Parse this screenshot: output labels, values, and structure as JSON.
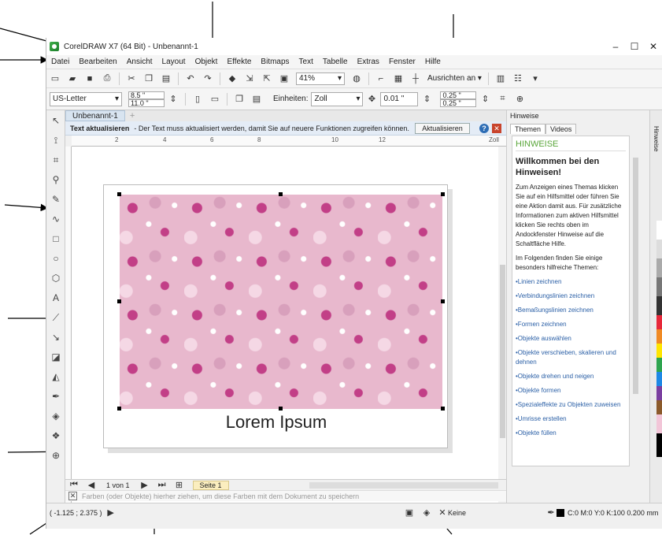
{
  "window": {
    "title": "CorelDRAW X7 (64 Bit) - Unbenannt-1",
    "minimize": "–",
    "maximize": "☐",
    "close": "✕"
  },
  "menu": [
    "Datei",
    "Bearbeiten",
    "Ansicht",
    "Layout",
    "Objekt",
    "Effekte",
    "Bitmaps",
    "Text",
    "Tabelle",
    "Extras",
    "Fenster",
    "Hilfe"
  ],
  "toolbar": {
    "zoom": "41%",
    "align_label": "Ausrichten an ▾"
  },
  "propbar": {
    "page_size": "US-Letter",
    "width": "8.5 \"",
    "height": "11.0 \"",
    "units_label": "Einheiten:",
    "units_value": "Zoll",
    "nudge": "0.01 \"",
    "dup_x": "0.25 \"",
    "dup_y": "0.25 \""
  },
  "doc": {
    "tab": "Unbenannt-1",
    "info_title": "Text aktualisieren",
    "info_message": "-  Der Text muss aktualisiert werden, damit Sie auf neuere Funktionen zugreifen können.",
    "update_button": "Aktualisieren",
    "ruler_unit": "Zoll",
    "canvas_text": "Lorem Ipsum",
    "ruler_ticks": [
      "2",
      "4",
      "6",
      "8",
      "10",
      "12"
    ]
  },
  "pager": {
    "page_of": "1 von 1",
    "page_tab": "Seite 1"
  },
  "colorbar": {
    "hint": "Farben (oder Objekte) hierher ziehen, um diese Farben mit dem Dokument zu speichern"
  },
  "status": {
    "coords": "( -1.125 ; 2.375 )",
    "fill": "Keine",
    "outline": "C:0 M:0 Y:0 K:100  0.200 mm"
  },
  "docker": {
    "title": "Hinweise",
    "tabs": [
      "Themen",
      "Videos"
    ],
    "heading": "HINWEISE",
    "welcome": "Willkommen bei den Hinweisen!",
    "intro": "Zum Anzeigen eines Themas klicken Sie auf ein Hilfsmittel oder führen Sie eine Aktion damit aus. Für zusätzliche Informationen zum aktiven Hilfsmittel klicken Sie rechts oben im Andockfenster Hinweise auf die Schaltfläche Hilfe.",
    "subintro": "Im Folgenden finden Sie einige besonders hilfreiche Themen:",
    "links": [
      "•Linien zeichnen",
      "•Verbindungslinien zeichnen",
      "•Bemaßungslinien zeichnen",
      "•Formen zeichnen",
      "•Objekte auswählen",
      "•Objekte verschieben, skalieren und dehnen",
      "•Objekte drehen und neigen",
      "•Objekte formen",
      "•Spezialeffekte zu Objekten zuweisen",
      "•Umrisse erstellen",
      "•Objekte füllen"
    ],
    "side_label": "Hinweise"
  }
}
